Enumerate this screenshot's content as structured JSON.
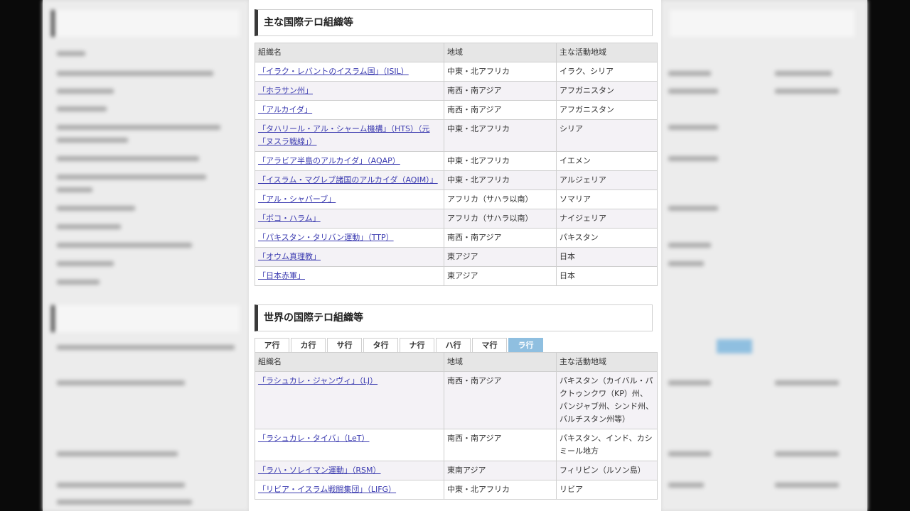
{
  "section1": {
    "title": "主な国際テロ組織等",
    "headers": [
      "組織名",
      "地域",
      "主な活動地域"
    ],
    "rows": [
      {
        "name": "「イラク・レバントのイスラム国」（ISIL）",
        "region": "中東・北アフリカ",
        "area": "イラク、シリア"
      },
      {
        "name": "「ホラサン州」",
        "region": "南西・南アジア",
        "area": "アフガニスタン"
      },
      {
        "name": "「アルカイダ」",
        "region": "南西・南アジア",
        "area": "アフガニスタン"
      },
      {
        "name": "「タハリール・アル・シャーム機構」（HTS）（元「ヌスラ戦線」）",
        "region": "中東・北アフリカ",
        "area": "シリア"
      },
      {
        "name": "「アラビア半島のアルカイダ」（AQAP）",
        "region": "中東・北アフリカ",
        "area": "イエメン"
      },
      {
        "name": "「イスラム・マグレブ諸国のアルカイダ（AQIM）」",
        "region": "中東・北アフリカ",
        "area": "アルジェリア"
      },
      {
        "name": "「アル・シャバーブ」",
        "region": "アフリカ（サハラ以南）",
        "area": "ソマリア"
      },
      {
        "name": "「ボコ・ハラム」",
        "region": "アフリカ（サハラ以南）",
        "area": "ナイジェリア"
      },
      {
        "name": "「パキスタン・タリバン運動」（TTP）",
        "region": "南西・南アジア",
        "area": "パキスタン"
      },
      {
        "name": "「オウム真理教」",
        "region": "東アジア",
        "area": "日本"
      },
      {
        "name": "「日本赤軍」",
        "region": "東アジア",
        "area": "日本"
      }
    ]
  },
  "section2": {
    "title": "世界の国際テロ組織等",
    "tabs": [
      "ア行",
      "カ行",
      "サ行",
      "タ行",
      "ナ行",
      "ハ行",
      "マ行",
      "ラ行"
    ],
    "active_tab": "ラ行",
    "headers": [
      "組織名",
      "地域",
      "主な活動地域"
    ],
    "rows": [
      {
        "name": "「ラシュカレ・ジャンヴィ」（LJ）",
        "region": "南西・南アジア",
        "area": "パキスタン（カイバル・パクトゥンクワ（KP）州、パンジャブ州、シンド州、バルチスタン州等）"
      },
      {
        "name": "「ラシュカレ・タイバ」（LeT）",
        "region": "南西・南アジア",
        "area": "パキスタン、インド、カシミール地方"
      },
      {
        "name": "「ラハ・ソレイマン運動」（RSM）",
        "region": "東南アジア",
        "area": "フィリピン（ルソン島）"
      },
      {
        "name": "「リビア・イスラム戦闘集団」（LIFG）",
        "region": "中東・北アフリカ",
        "area": "リビア"
      }
    ]
  },
  "colors": {
    "tab_active": "#8fbfe0",
    "link": "#3b3bb0",
    "heading_border": "#3a3a3a"
  }
}
